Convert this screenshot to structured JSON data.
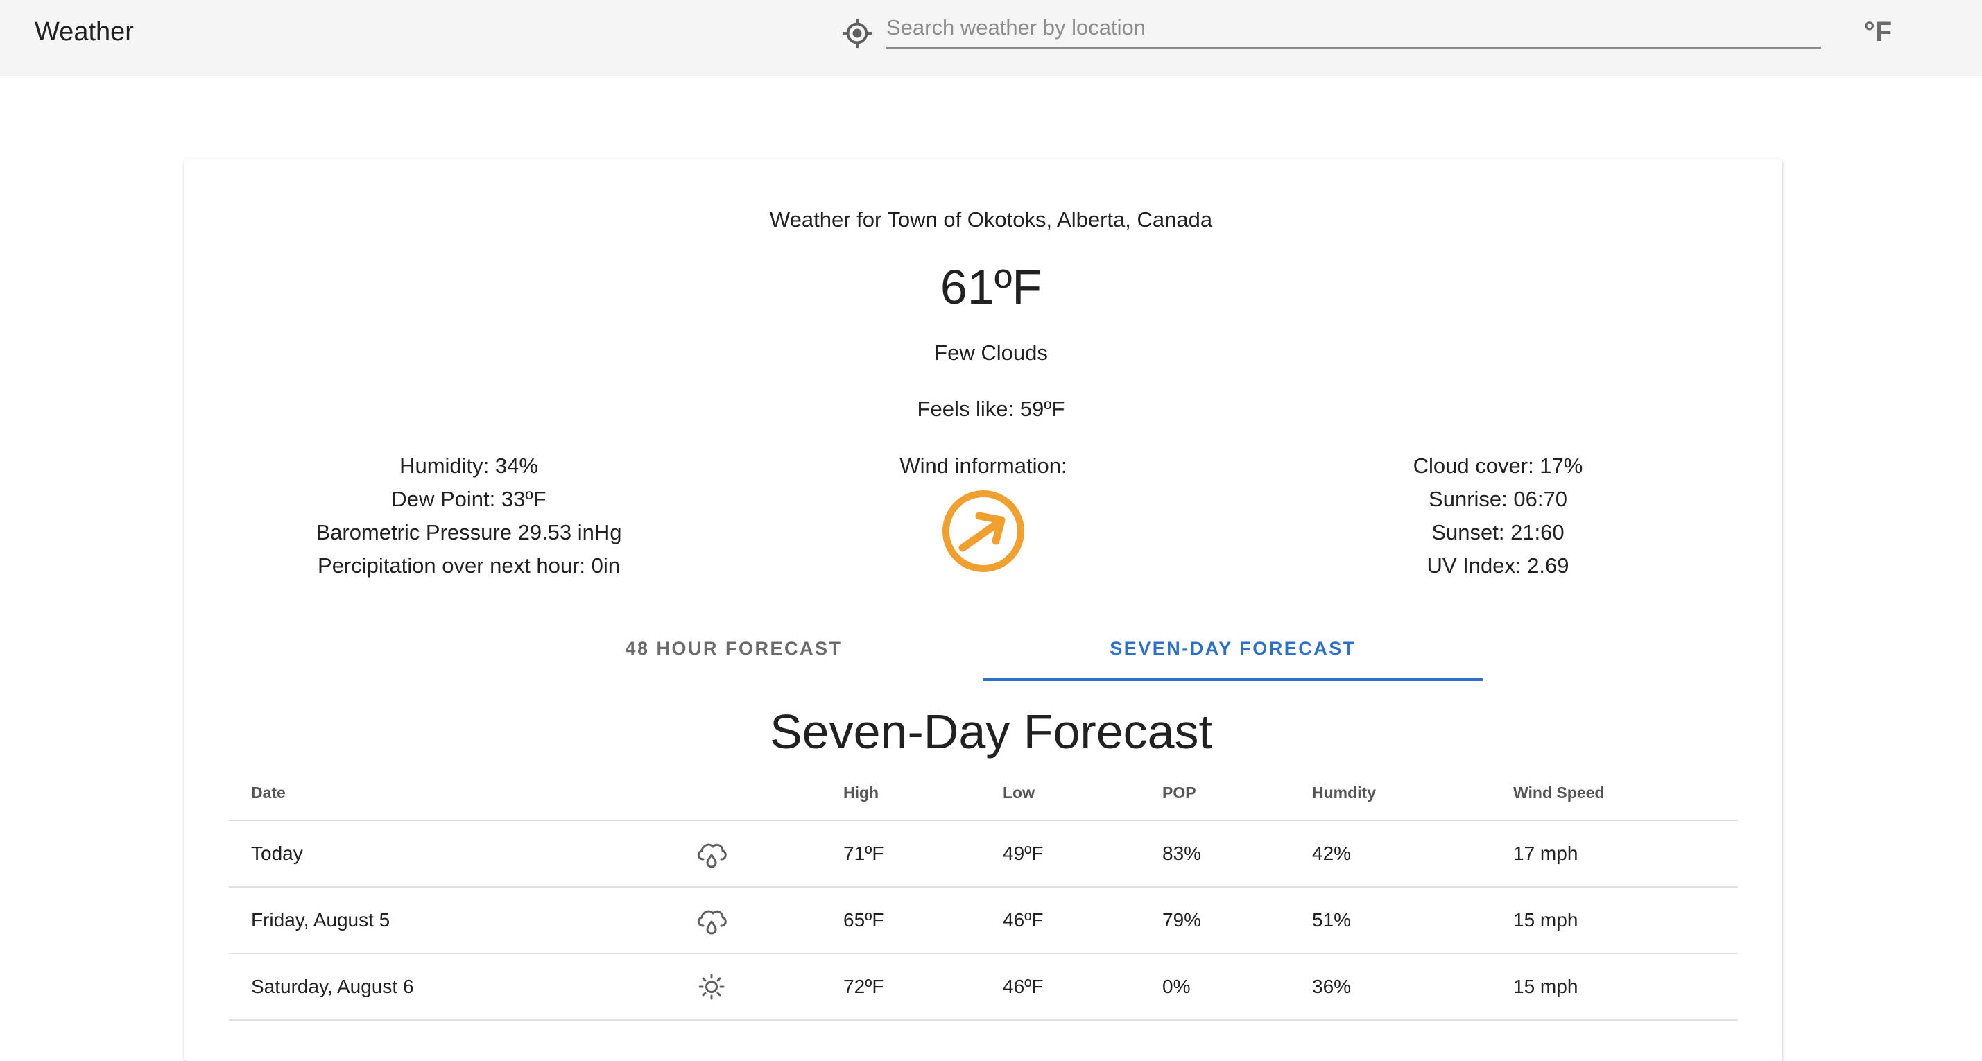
{
  "appbar": {
    "title": "Weather",
    "search_placeholder": "Search weather by location",
    "search_value": "",
    "unit": "°F",
    "locate_icon": "my-location-icon"
  },
  "current": {
    "location_title": "Weather for Town of Okotoks, Alberta, Canada",
    "temperature": "61ºF",
    "condition": "Few Clouds",
    "feels_like": "Feels like: 59ºF",
    "left": {
      "humidity": "Humidity: 34%",
      "dew_point": "Dew Point: 33ºF",
      "pressure": "Barometric Pressure 29.53 inHg",
      "precip": "Percipitation over next hour: 0in"
    },
    "wind": {
      "label": "Wind information:",
      "icon": "wind-direction-arrow-icon",
      "color": "#f0a030"
    },
    "right": {
      "cloud_cover": "Cloud cover: 17%",
      "sunrise": "Sunrise: 06:70",
      "sunset": "Sunset: 21:60",
      "uv": "UV Index: 2.69"
    }
  },
  "tabs": [
    {
      "label": "48 HOUR FORECAST",
      "active": false
    },
    {
      "label": "SEVEN-DAY FORECAST",
      "active": true
    }
  ],
  "accent_color": "#2f6fc5",
  "forecast": {
    "title": "Seven-Day Forecast",
    "headers": [
      "Date",
      "",
      "High",
      "Low",
      "POP",
      "Humdity",
      "Wind Speed"
    ],
    "rows": [
      {
        "date": "Today",
        "icon": "rain-cloud-icon",
        "high": "71ºF",
        "low": "49ºF",
        "pop": "83%",
        "humidity": "42%",
        "wind": "17 mph"
      },
      {
        "date": "Friday, August 5",
        "icon": "rain-cloud-icon",
        "high": "65ºF",
        "low": "46ºF",
        "pop": "79%",
        "humidity": "51%",
        "wind": "15 mph"
      },
      {
        "date": "Saturday, August 6",
        "icon": "sun-icon",
        "high": "72ºF",
        "low": "46ºF",
        "pop": "0%",
        "humidity": "36%",
        "wind": "15 mph"
      }
    ]
  }
}
